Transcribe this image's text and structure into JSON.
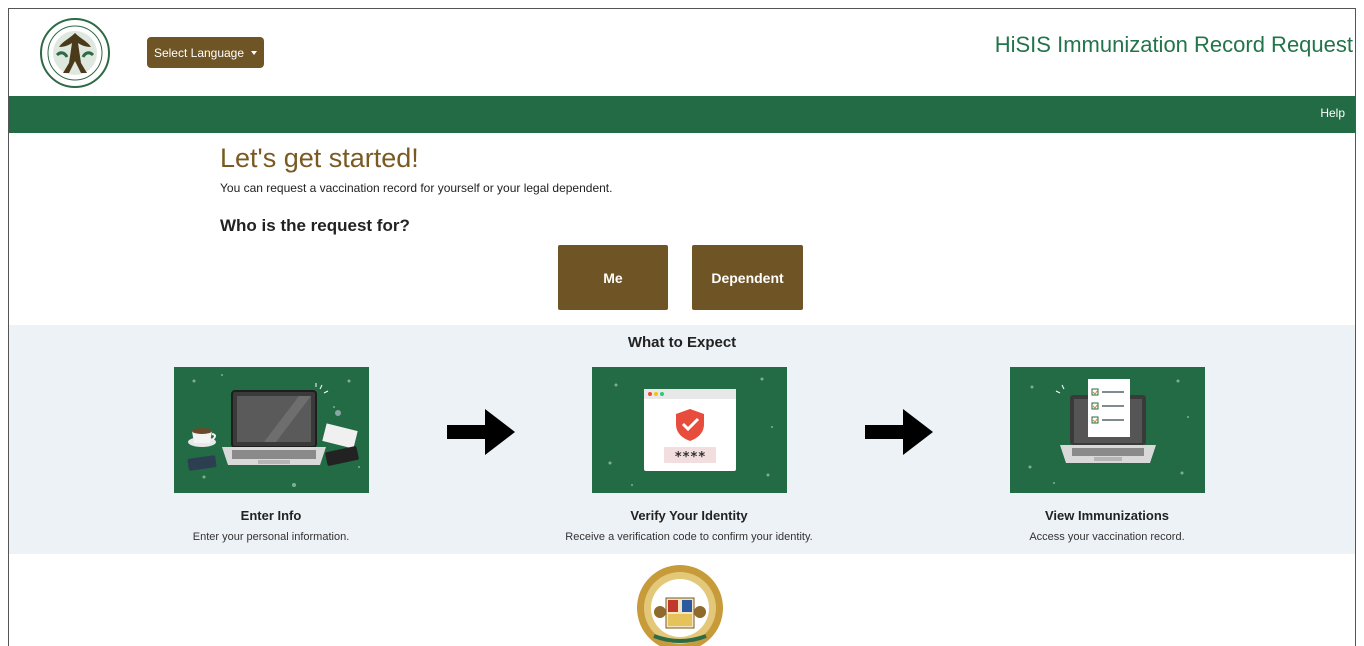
{
  "header": {
    "language_button": "Select Language",
    "app_title": "HiSIS Immunization Record Request"
  },
  "nav": {
    "help": "Help"
  },
  "main": {
    "title": "Let's get started!",
    "subtitle": "You can request a vaccination record for yourself or your legal dependent.",
    "question": "Who is the request for?",
    "me_button": "Me",
    "dependent_button": "Dependent"
  },
  "expect": {
    "title": "What to Expect",
    "steps": [
      {
        "title": "Enter Info",
        "description": "Enter your personal information."
      },
      {
        "title": "Verify Your Identity",
        "description": "Receive a verification code to confirm your identity.",
        "code_mask": "****"
      },
      {
        "title": "View Immunizations",
        "description": "Access your vaccination record."
      }
    ]
  },
  "colors": {
    "brand_green": "#226b45",
    "title_green": "#23744a",
    "button_brown": "#6f5525",
    "heading_brown": "#7a5a22",
    "expect_bg": "#edf2f7"
  },
  "icons": {
    "department_logo": "hawaii-doh-seal-icon",
    "state_seal": "state-of-hawaii-seal-icon",
    "arrow": "arrow-right-icon"
  }
}
